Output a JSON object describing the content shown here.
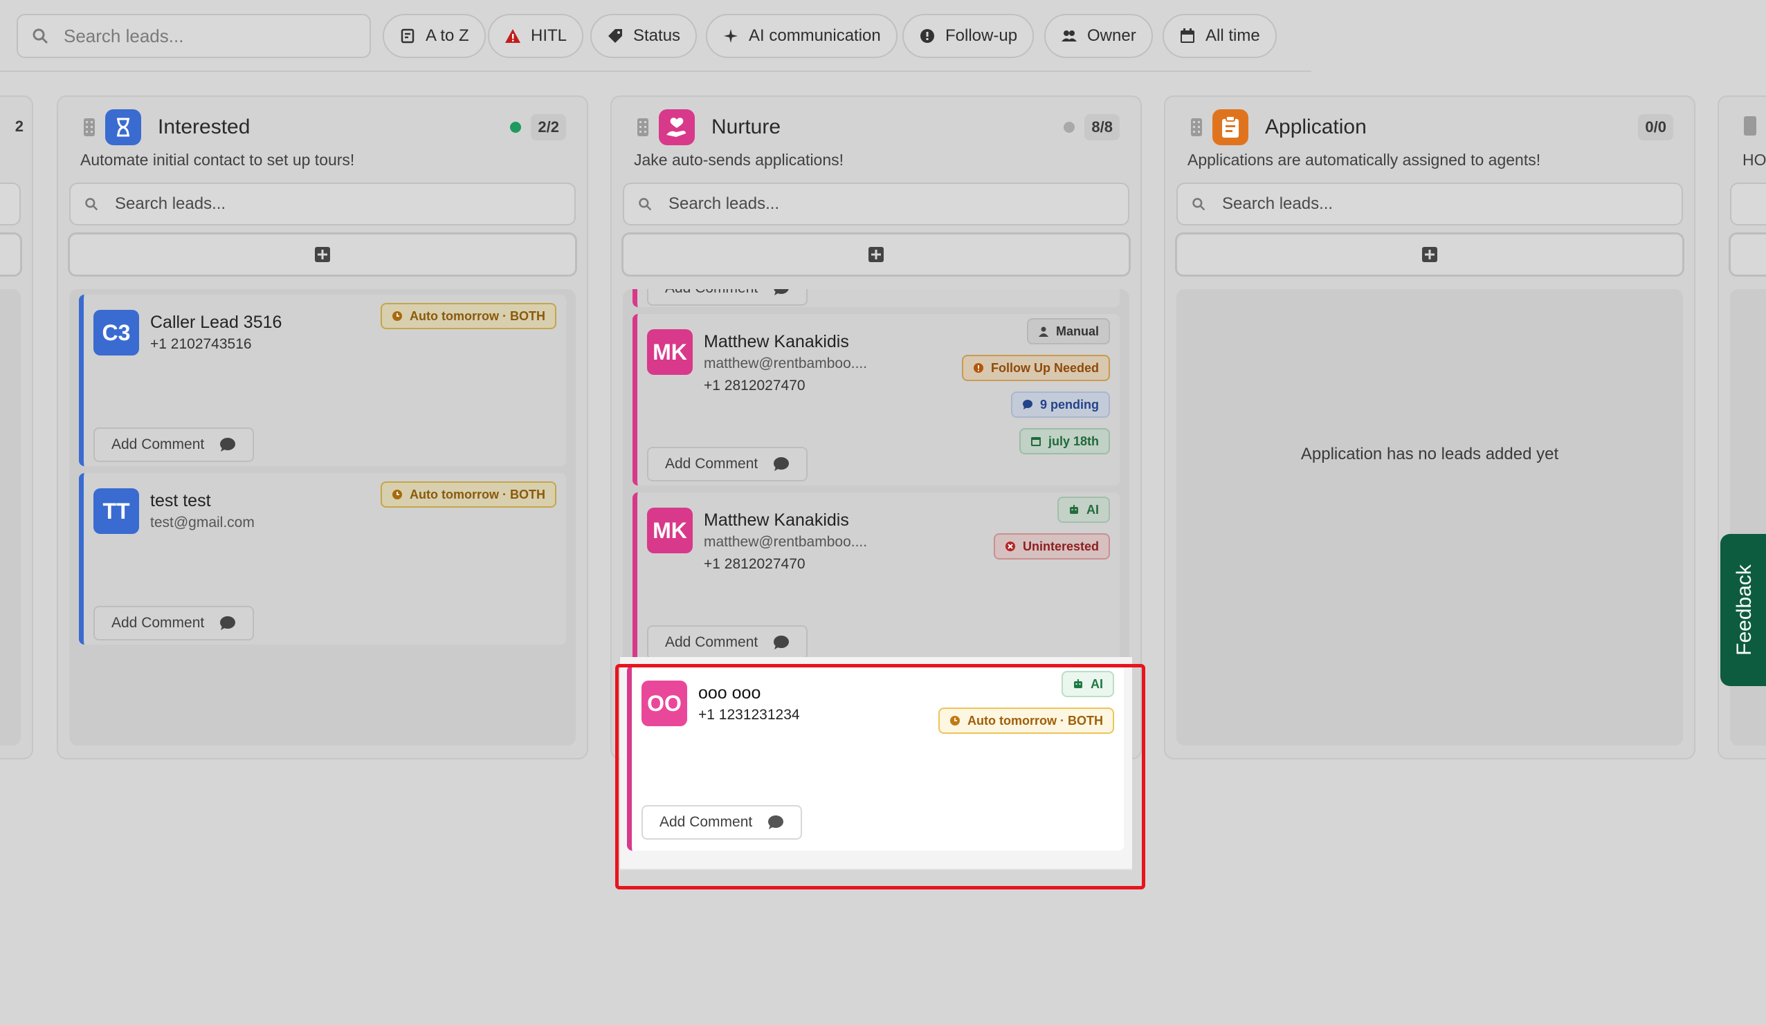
{
  "toolbar": {
    "search_placeholder": "Search leads...",
    "chips": {
      "sort": "A to Z",
      "hitl": "HITL",
      "status": "Status",
      "ai_comm": "AI communication",
      "follow_up": "Follow-up",
      "owner": "Owner",
      "time": "All time"
    }
  },
  "left_col": {
    "count": "2",
    "peek": "HO"
  },
  "columns": {
    "interested": {
      "title": "Interested",
      "count": "2/2",
      "subtitle": "Automate initial contact to set up tours!",
      "search_placeholder": "Search leads...",
      "cards": [
        {
          "initials": "C3",
          "name": "Caller Lead 3516",
          "line1": "+1 2102743516",
          "badge": "Auto tomorrow · BOTH",
          "comment": "Add Comment"
        },
        {
          "initials": "TT",
          "name": "test test",
          "line1": "test@gmail.com",
          "badge": "Auto tomorrow · BOTH",
          "comment": "Add Comment"
        }
      ]
    },
    "nurture": {
      "title": "Nurture",
      "count": "8/8",
      "subtitle": "Jake auto-sends applications!",
      "search_placeholder": "Search leads...",
      "top_comment": "Add Comment",
      "cards": [
        {
          "initials": "MK",
          "name": "Matthew Kanakidis",
          "line1": "matthew@rentbamboo....",
          "line2": "+1 2812027470",
          "badges": [
            "Manual",
            "Follow Up Needed",
            "9 pending",
            "july 18th"
          ],
          "comment": "Add Comment"
        },
        {
          "initials": "MK",
          "name": "Matthew Kanakidis",
          "line1": "matthew@rentbamboo....",
          "line2": "+1 2812027470",
          "badges": [
            "AI",
            "Uninterested"
          ],
          "comment": "Add Comment"
        },
        {
          "initials": "OO",
          "name": "ooo ooo",
          "line1": "+1 1231231234",
          "badges": [
            "AI",
            "Auto tomorrow · BOTH"
          ],
          "comment": "Add Comment"
        }
      ]
    },
    "application": {
      "title": "Application",
      "count": "0/0",
      "subtitle": "Applications are automatically assigned to agents!",
      "search_placeholder": "Search leads...",
      "empty": "Application has no leads added yet"
    }
  },
  "feedback": "Feedback",
  "colors": {
    "interested_accent": "#3a6bd0",
    "nurture_accent": "#d8398a",
    "application_accent": "#e0741e",
    "highlight": "#e8141c",
    "feedback_bg": "#0d5c3f"
  }
}
